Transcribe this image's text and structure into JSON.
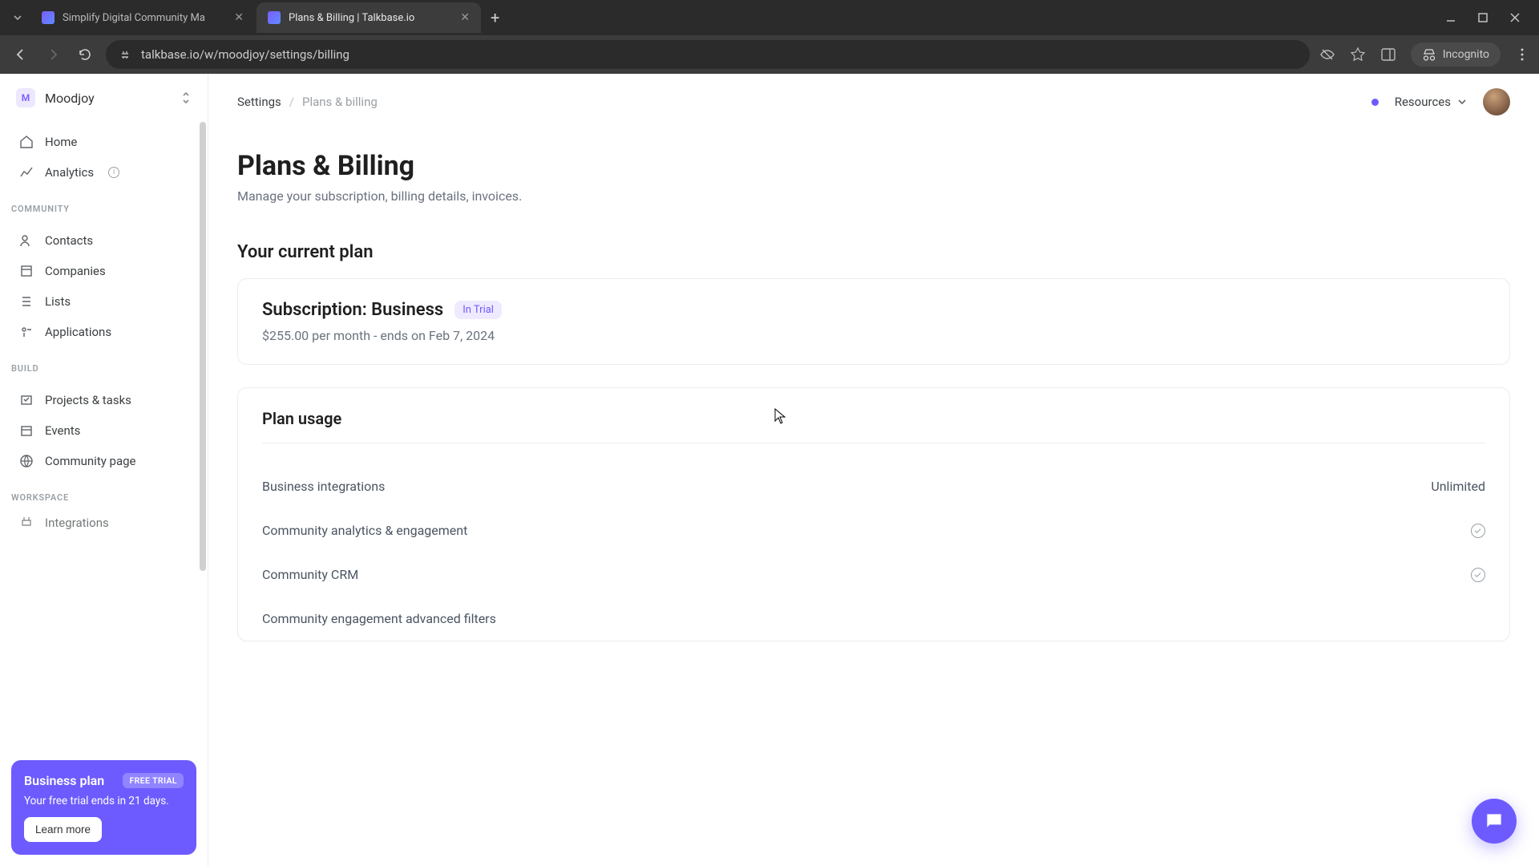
{
  "browser": {
    "tabs": [
      {
        "title": "Simplify Digital Community Ma"
      },
      {
        "title": "Plans & Billing | Talkbase.io"
      }
    ],
    "url": "talkbase.io/w/moodjoy/settings/billing",
    "incognito_label": "Incognito"
  },
  "workspace": {
    "initial": "M",
    "name": "Moodjoy"
  },
  "sidebar": {
    "items_top": [
      {
        "label": "Home"
      },
      {
        "label": "Analytics"
      }
    ],
    "community_label": "COMMUNITY",
    "items_community": [
      {
        "label": "Contacts"
      },
      {
        "label": "Companies"
      },
      {
        "label": "Lists"
      },
      {
        "label": "Applications"
      }
    ],
    "build_label": "BUILD",
    "items_build": [
      {
        "label": "Projects & tasks"
      },
      {
        "label": "Events"
      },
      {
        "label": "Community page"
      }
    ],
    "workspace_label": "WORKSPACE",
    "items_workspace": [
      {
        "label": "Integrations"
      }
    ]
  },
  "trial_card": {
    "title": "Business plan",
    "badge": "FREE TRIAL",
    "subtitle": "Your free trial ends in 21 days.",
    "button": "Learn more"
  },
  "breadcrumb": {
    "root": "Settings",
    "leaf": "Plans & billing"
  },
  "topbar": {
    "resources": "Resources"
  },
  "page": {
    "title": "Plans & Billing",
    "subtitle": "Manage your subscription, billing details, invoices."
  },
  "current_plan": {
    "section": "Your current plan",
    "name": "Subscription: Business",
    "badge": "In Trial",
    "meta": "$255.00 per month - ends on Feb 7, 2024"
  },
  "usage": {
    "section": "Plan usage",
    "rows": [
      {
        "label": "Business integrations",
        "value": "Unlimited"
      },
      {
        "label": "Community analytics & engagement",
        "value": "check"
      },
      {
        "label": "Community CRM",
        "value": "check"
      },
      {
        "label": "Community engagement advanced filters",
        "value": ""
      }
    ]
  }
}
